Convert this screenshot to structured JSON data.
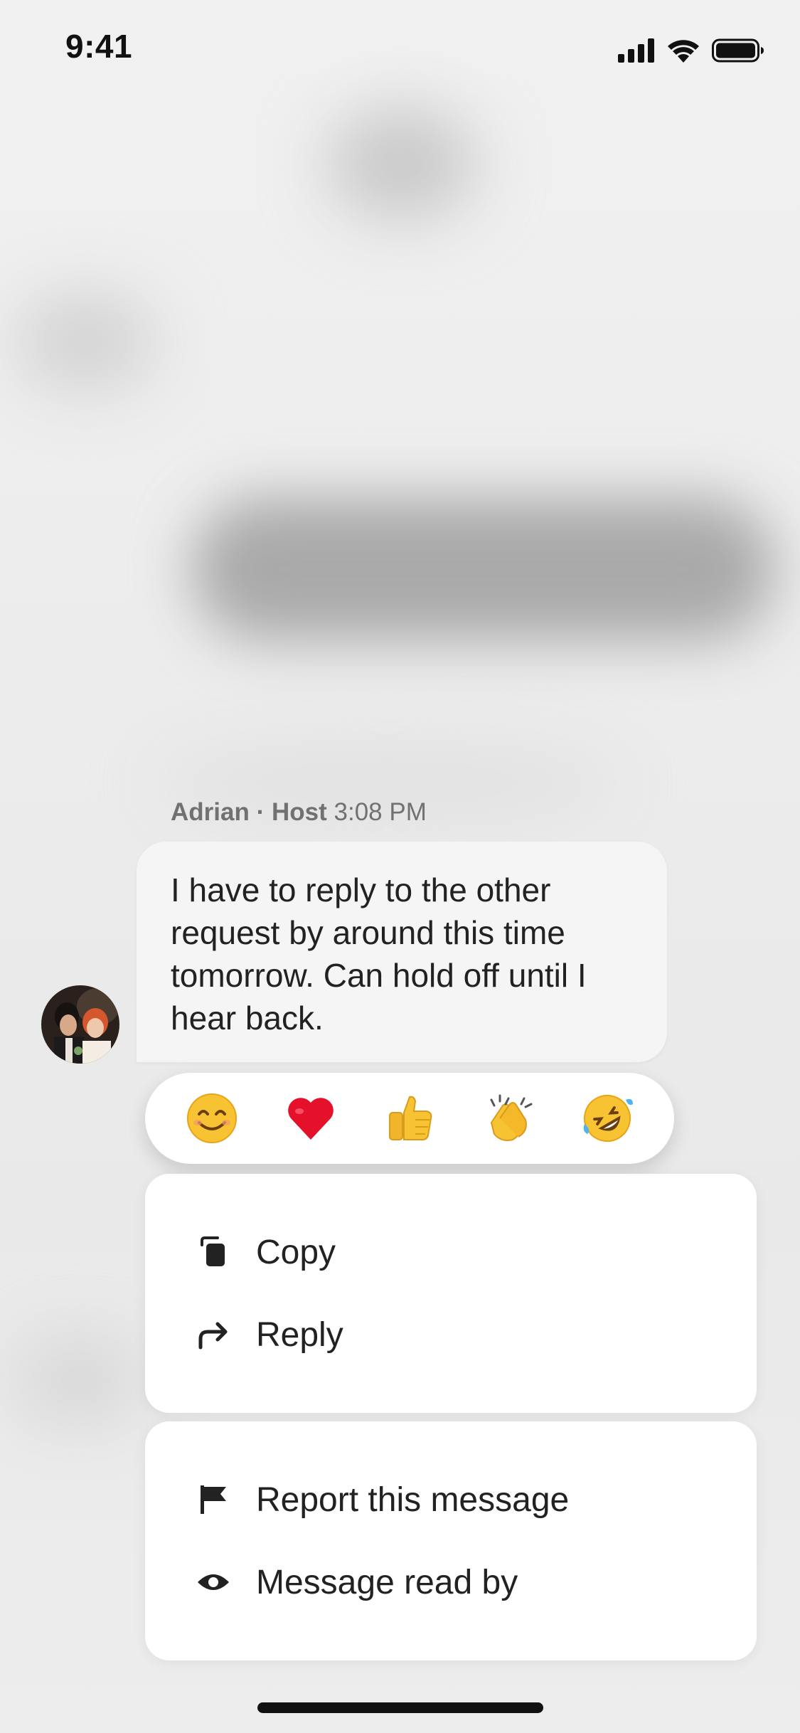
{
  "status_bar": {
    "time": "9:41",
    "icons": [
      "signal-icon",
      "wifi-icon",
      "battery-icon"
    ]
  },
  "message": {
    "sender_name": "Adrian",
    "separator": "·",
    "sender_role": "Host",
    "timestamp": "3:08 PM",
    "text": "I have to reply to the other request by around this time tomorrow. Can hold off until I hear back."
  },
  "reactions": [
    {
      "name": "smiling-face",
      "icon": "smile-emoji-icon"
    },
    {
      "name": "red-heart",
      "icon": "heart-emoji-icon"
    },
    {
      "name": "thumbs-up",
      "icon": "thumbs-up-emoji-icon"
    },
    {
      "name": "clapping-hands",
      "icon": "clap-emoji-icon"
    },
    {
      "name": "rolling-laughing",
      "icon": "rofl-emoji-icon"
    }
  ],
  "menu_primary": [
    {
      "label": "Copy",
      "icon": "copy-icon"
    },
    {
      "label": "Reply",
      "icon": "reply-arrow-icon"
    }
  ],
  "menu_secondary": [
    {
      "label": "Report this message",
      "icon": "flag-icon"
    },
    {
      "label": "Message read by",
      "icon": "eye-icon"
    }
  ],
  "colors": {
    "text_primary": "#222222",
    "text_secondary": "#717171",
    "bubble": "#f5f5f5",
    "card": "#ffffff"
  }
}
